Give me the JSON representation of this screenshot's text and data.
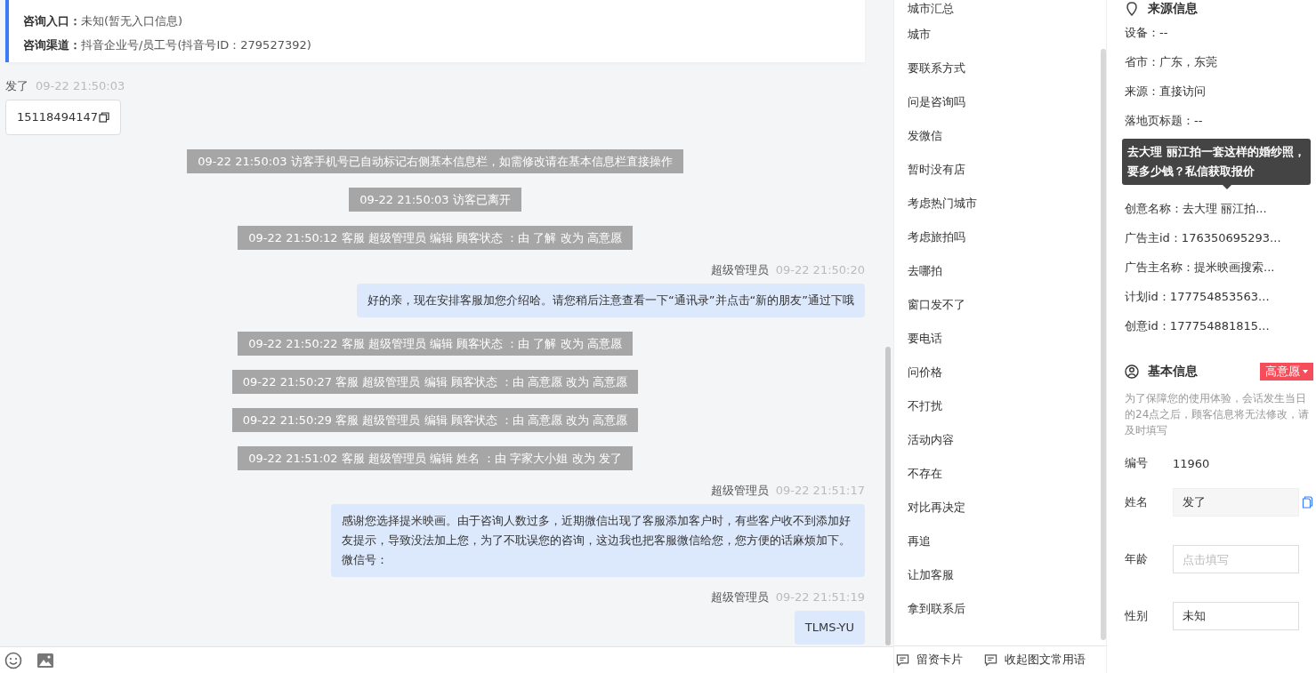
{
  "consult_card": {
    "rows": [
      {
        "label": "咨询入口：",
        "value": "未知(暂无入口信息)"
      },
      {
        "label": "咨询渠道：",
        "value": "抖音企业号/员工号(抖音号ID：279527392)"
      }
    ]
  },
  "messages": [
    {
      "kind": "visitor",
      "name": "发了",
      "time": "09-22 21:50:03",
      "text": "15118494147"
    },
    {
      "kind": "system",
      "text": "09-22 21:50:03 访客手机号已自动标记右侧基本信息栏，如需修改请在基本信息栏直接操作"
    },
    {
      "kind": "system",
      "text": "09-22 21:50:03 访客已离开"
    },
    {
      "kind": "system",
      "text": "09-22 21:50:12 客服 超级管理员 编辑 顾客状态 ：由 了解 改为 高意愿"
    },
    {
      "kind": "agent",
      "name": "超级管理员",
      "time": "09-22 21:50:20",
      "text": "好的亲，现在安排客服加您介绍哈。请您稍后注意查看一下“通讯录”并点击“新的朋友”通过下哦"
    },
    {
      "kind": "system",
      "text": "09-22 21:50:22 客服 超级管理员 编辑 顾客状态 ：由 了解 改为 高意愿"
    },
    {
      "kind": "system",
      "text": "09-22 21:50:27 客服 超级管理员 编辑 顾客状态 ：由 高意愿 改为 高意愿"
    },
    {
      "kind": "system",
      "text": "09-22 21:50:29 客服 超级管理员 编辑 顾客状态 ：由 高意愿 改为 高意愿"
    },
    {
      "kind": "system",
      "text": "09-22 21:51:02 客服 超级管理员 编辑 姓名 ：由 字家大小姐 改为 发了"
    },
    {
      "kind": "agent",
      "name": "超级管理员",
      "time": "09-22 21:51:17",
      "text": "感谢您选择提米映画。由于咨询人数过多，近期微信出现了客服添加客户时，有些客户收不到添加好友提示，导致没法加上您，为了不耽误您的咨询，这边我也把客服微信给您，您方便的话麻烦加下。微信号："
    },
    {
      "kind": "agent",
      "name": "超级管理员",
      "time": "09-22 21:51:19",
      "text": "TLMS-YU"
    }
  ],
  "phrases": {
    "items": [
      "城市汇总",
      "城市",
      "要联系方式",
      "问是咨询吗",
      "发微信",
      "暂时没有店",
      "考虑热门城市",
      "考虑旅拍吗",
      "去哪拍",
      "窗口发不了",
      "要电话",
      "问价格",
      "不打扰",
      "活动内容",
      "不存在",
      "对比再决定",
      "再追",
      "让加客服",
      "拿到联系后"
    ],
    "buttons": [
      "留资卡片",
      "收起图文常用语"
    ]
  },
  "source_info": {
    "title": "来源信息",
    "rows": [
      {
        "kind": "row",
        "text": "设备：--"
      },
      {
        "kind": "row",
        "text": "省市：广东，东莞"
      },
      {
        "kind": "row",
        "text": "来源：直接访问"
      },
      {
        "kind": "row",
        "text": "落地页标题：--"
      },
      {
        "kind": "tooltip",
        "text": "去大理 丽江拍一套这样的婚纱照，要多少钱？私信获取报价"
      },
      {
        "kind": "row",
        "text": "创意名称：去大理 丽江拍..."
      },
      {
        "kind": "row",
        "text": "广告主id：176350695293..."
      },
      {
        "kind": "row",
        "text": "广告主名称：提米映画搜索..."
      },
      {
        "kind": "row",
        "text": "计划id：177754853563..."
      },
      {
        "kind": "row",
        "text": "创意id：177754881815..."
      }
    ]
  },
  "basic_info": {
    "title": "基本信息",
    "intent_tag": "高意愿",
    "note": "为了保障您的使用体验，会话发生当日的24点之后，顾客信息将无法修改，请及时填写",
    "fields": [
      {
        "kind": "text",
        "label": "编号",
        "value": "11960"
      },
      {
        "kind": "filled",
        "label": "姓名",
        "value": "发了"
      },
      {
        "kind": "input",
        "label": "年龄",
        "placeholder": "点击填写"
      },
      {
        "kind": "select",
        "label": "性别",
        "value": "未知"
      }
    ]
  }
}
